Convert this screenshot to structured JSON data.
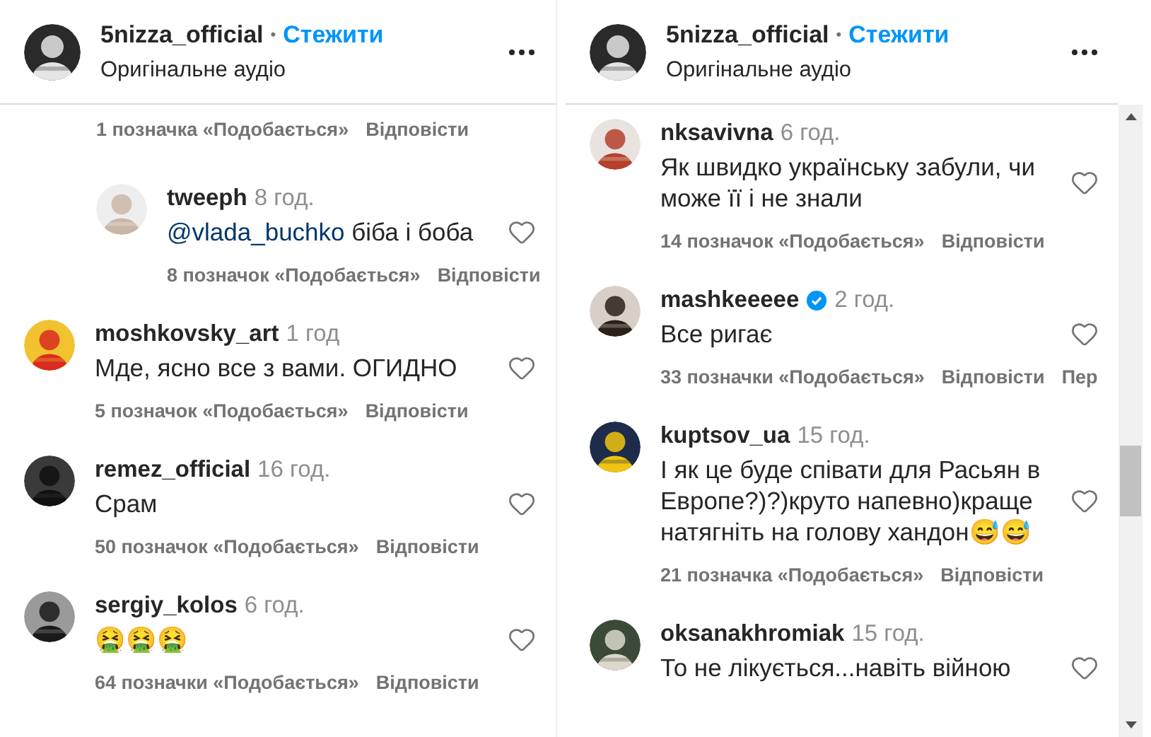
{
  "panels": [
    {
      "header": {
        "account": "5nizza_official",
        "separator": "•",
        "follow": "Стежити",
        "subtitle": "Оригінальне аудіо"
      },
      "comments": [
        {
          "kind": "tail",
          "likes": "1 позначка «Подобається»",
          "actions": [
            "Відповісти"
          ]
        },
        {
          "kind": "reply",
          "user": "tweeph",
          "verified": false,
          "time": "8 год.",
          "mention": "@vlada_buchko",
          "text": "біба і боба",
          "likes": "8 позначок «Подобається»",
          "actions": [
            "Відповісти"
          ]
        },
        {
          "kind": "comment",
          "user": "moshkovsky_art",
          "verified": false,
          "time": "1 год",
          "text": "Мде, ясно все з вами. ОГИДНО",
          "likes": "5 позначок «Подобається»",
          "actions": [
            "Відповісти"
          ]
        },
        {
          "kind": "comment",
          "user": "remez_official",
          "verified": false,
          "time": "16 год.",
          "text": "Срам",
          "likes": "50 позначок «Подобається»",
          "actions": [
            "Відповісти"
          ]
        },
        {
          "kind": "comment",
          "user": "sergiy_kolos",
          "verified": false,
          "time": "6 год.",
          "text": "🤮🤮🤮",
          "likes": "64 позначки «Подобається»",
          "actions": [
            "Відповісти"
          ]
        }
      ]
    },
    {
      "header": {
        "account": "5nizza_official",
        "separator": "•",
        "follow": "Стежити",
        "subtitle": "Оригінальне аудіо"
      },
      "comments": [
        {
          "kind": "comment",
          "user": "nksavivna",
          "verified": false,
          "time": "6 год.",
          "text": "Як швидко українську забули, чи може її і не знали",
          "likes": "14 позначок «Подобається»",
          "actions": [
            "Відповісти"
          ]
        },
        {
          "kind": "comment",
          "user": "mashkeeeee",
          "verified": true,
          "time": "2 год.",
          "text": "Все ригає",
          "likes": "33 позначки «Подобається»",
          "actions": [
            "Відповісти",
            "Пер"
          ]
        },
        {
          "kind": "comment",
          "user": "kuptsov_ua",
          "verified": false,
          "time": "15 год.",
          "text": "І як це буде співати для Расьян в Европе?)?)круто напевно)краще натягніть на голову хандон😅😅",
          "likes": "21 позначка «Подобається»",
          "actions": [
            "Відповісти"
          ]
        },
        {
          "kind": "comment",
          "user": "oksanakhromiak",
          "verified": false,
          "time": "15 год.",
          "text": "То не лікується...навіть війною"
        }
      ]
    }
  ]
}
